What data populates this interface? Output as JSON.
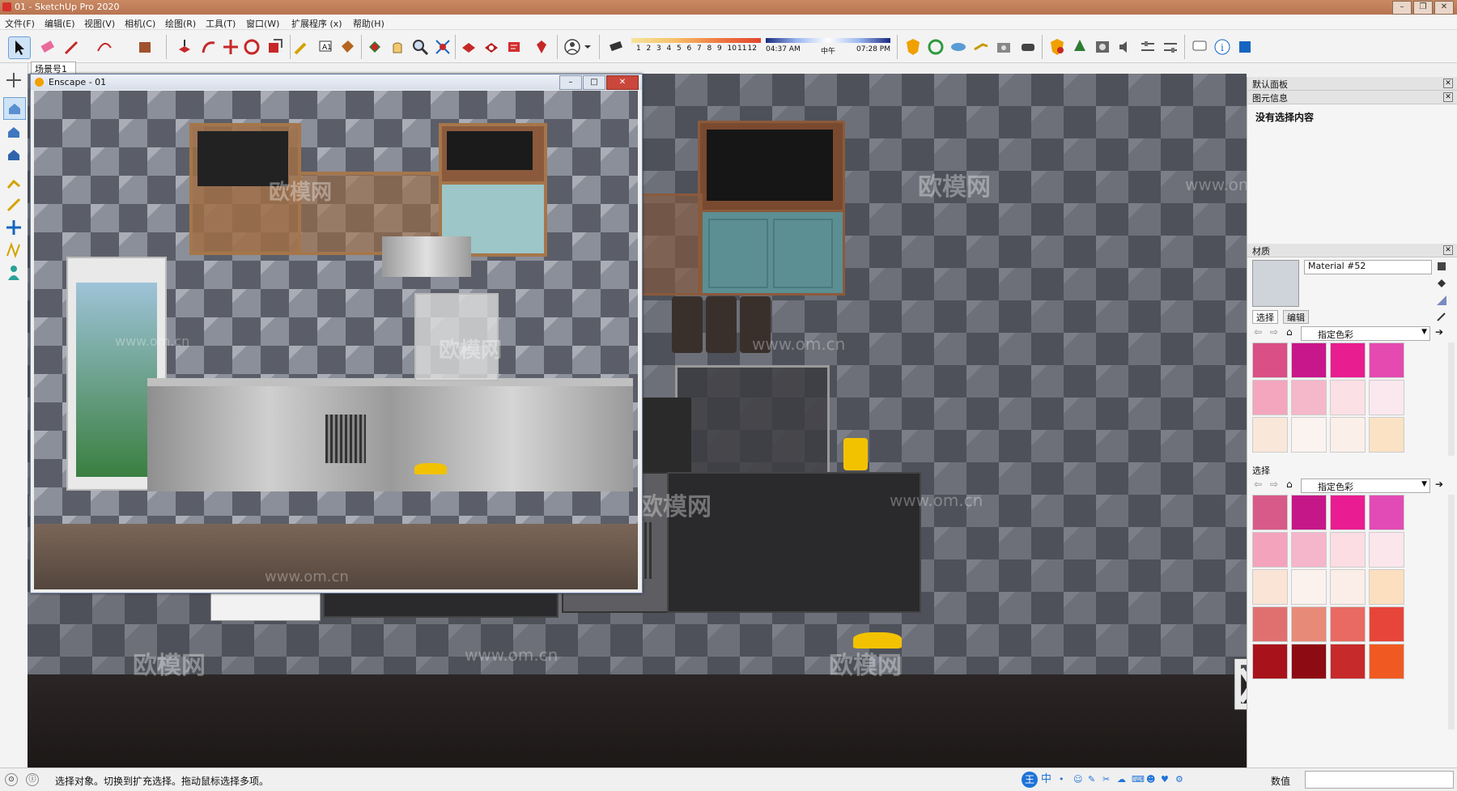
{
  "window": {
    "title": "01 - SketchUp Pro 2020"
  },
  "menu": [
    "文件(F)",
    "编辑(E)",
    "视图(V)",
    "相机(C)",
    "绘图(R)",
    "工具(T)",
    "窗口(W)",
    "扩展程序 (x)",
    "帮助(H)"
  ],
  "toolbar": {
    "shadow_scale": [
      "1",
      "2",
      "3",
      "4",
      "5",
      "6",
      "7",
      "8",
      "9",
      "10",
      "11",
      "12"
    ],
    "time_start": "04:37 AM",
    "time_mid": "中午",
    "time_end": "07:28 PM"
  },
  "scene_tab": "场景号1",
  "enscape": {
    "title": "Enscape - 01"
  },
  "panel": {
    "title": "默认面板",
    "entity_info": {
      "header": "图元信息",
      "empty": "没有选择内容"
    },
    "materials": {
      "header": "材质",
      "name": "Material #52",
      "tab_select": "选择",
      "tab_edit": "编辑",
      "collection": "指定色彩",
      "secondary_header": "选择",
      "secondary_collection": "指定色彩",
      "swatches_top": [
        "#d94f86",
        "#c8178a",
        "#e81d8f",
        "#e44ab0",
        "#f4a6bf",
        "#f5b8cb",
        "#fbe0e6",
        "#fbe8ef",
        "#f9e7da",
        "#fbf3ef",
        "#fbefe9",
        "#fbe2c4"
      ],
      "swatches_bottom": [
        "#d85a88",
        "#c61788",
        "#ea1c91",
        "#e24bb5",
        "#f4a3bd",
        "#f5b5ca",
        "#fbdde3",
        "#fbe6ec",
        "#f9e4d6",
        "#fbf2ee",
        "#fbede7",
        "#fbdfbe",
        "#e07070",
        "#e88a78",
        "#e86a62",
        "#e8453a",
        "#a8131b",
        "#8d0b12",
        "#c72a2a",
        "#f05a22"
      ]
    }
  },
  "status": {
    "text": "选择对象。切换到扩充选择。拖动鼠标选择多项。",
    "value_label": "数值"
  },
  "watermarks": {
    "brand": "欧模网",
    "url": "www.om.cn"
  }
}
